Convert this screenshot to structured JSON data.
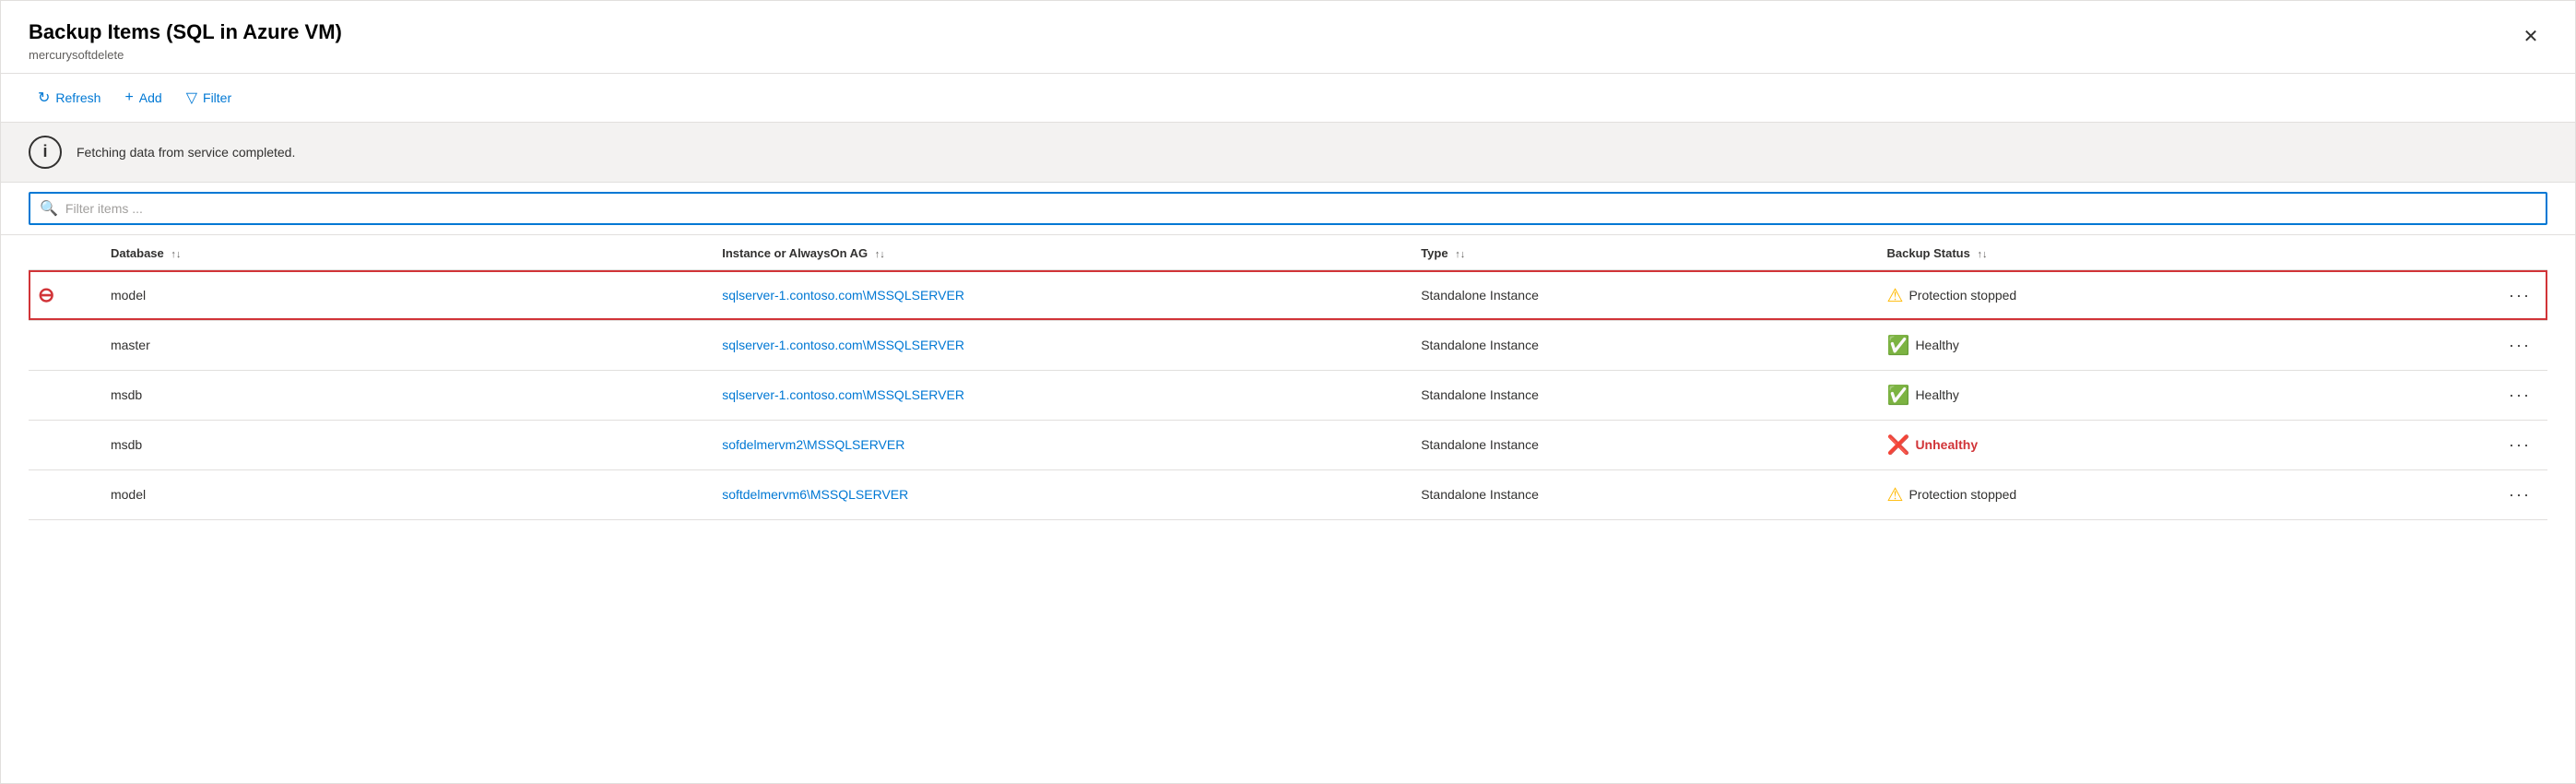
{
  "header": {
    "title": "Backup Items (SQL in Azure VM)",
    "subtitle": "mercurysoftdelete",
    "close_label": "×"
  },
  "toolbar": {
    "refresh_label": "Refresh",
    "add_label": "Add",
    "filter_label": "Filter"
  },
  "notification": {
    "message": "Fetching data from service completed."
  },
  "filter": {
    "placeholder": "Filter items ..."
  },
  "table": {
    "columns": [
      {
        "id": "icon",
        "label": ""
      },
      {
        "id": "database",
        "label": "Database"
      },
      {
        "id": "instance",
        "label": "Instance or AlwaysOn AG"
      },
      {
        "id": "type",
        "label": "Type"
      },
      {
        "id": "status",
        "label": "Backup Status"
      },
      {
        "id": "actions",
        "label": ""
      }
    ],
    "rows": [
      {
        "highlighted": true,
        "row_icon": "minus",
        "database": "model",
        "instance": "sqlserver-1.contoso.com\\MSSQLSERVER",
        "type": "Standalone Instance",
        "status": "Protection stopped",
        "status_type": "warning"
      },
      {
        "highlighted": false,
        "row_icon": "none",
        "database": "master",
        "instance": "sqlserver-1.contoso.com\\MSSQLSERVER",
        "type": "Standalone Instance",
        "status": "Healthy",
        "status_type": "healthy"
      },
      {
        "highlighted": false,
        "row_icon": "none",
        "database": "msdb",
        "instance": "sqlserver-1.contoso.com\\MSSQLSERVER",
        "type": "Standalone Instance",
        "status": "Healthy",
        "status_type": "healthy"
      },
      {
        "highlighted": false,
        "row_icon": "none",
        "database": "msdb",
        "instance": "sofdelmervm2\\MSSQLSERVER",
        "type": "Standalone Instance",
        "status": "Unhealthy",
        "status_type": "unhealthy"
      },
      {
        "highlighted": false,
        "row_icon": "none",
        "database": "model",
        "instance": "softdelmervm6\\MSSQLSERVER",
        "type": "Standalone Instance",
        "status": "Protection stopped",
        "status_type": "warning"
      }
    ]
  },
  "icons": {
    "refresh": "↻",
    "add": "+",
    "filter": "▽",
    "search": "🔍",
    "sort": "↑↓",
    "more": "•••",
    "info": "i",
    "close": "✕",
    "minus": "⊖",
    "check_green": "✔",
    "warning": "⚠",
    "error_x": "✘"
  },
  "colors": {
    "link": "#0078d4",
    "healthy": "#107c10",
    "warning": "#ffb900",
    "unhealthy": "#d13438",
    "highlight_border": "#d13438"
  }
}
